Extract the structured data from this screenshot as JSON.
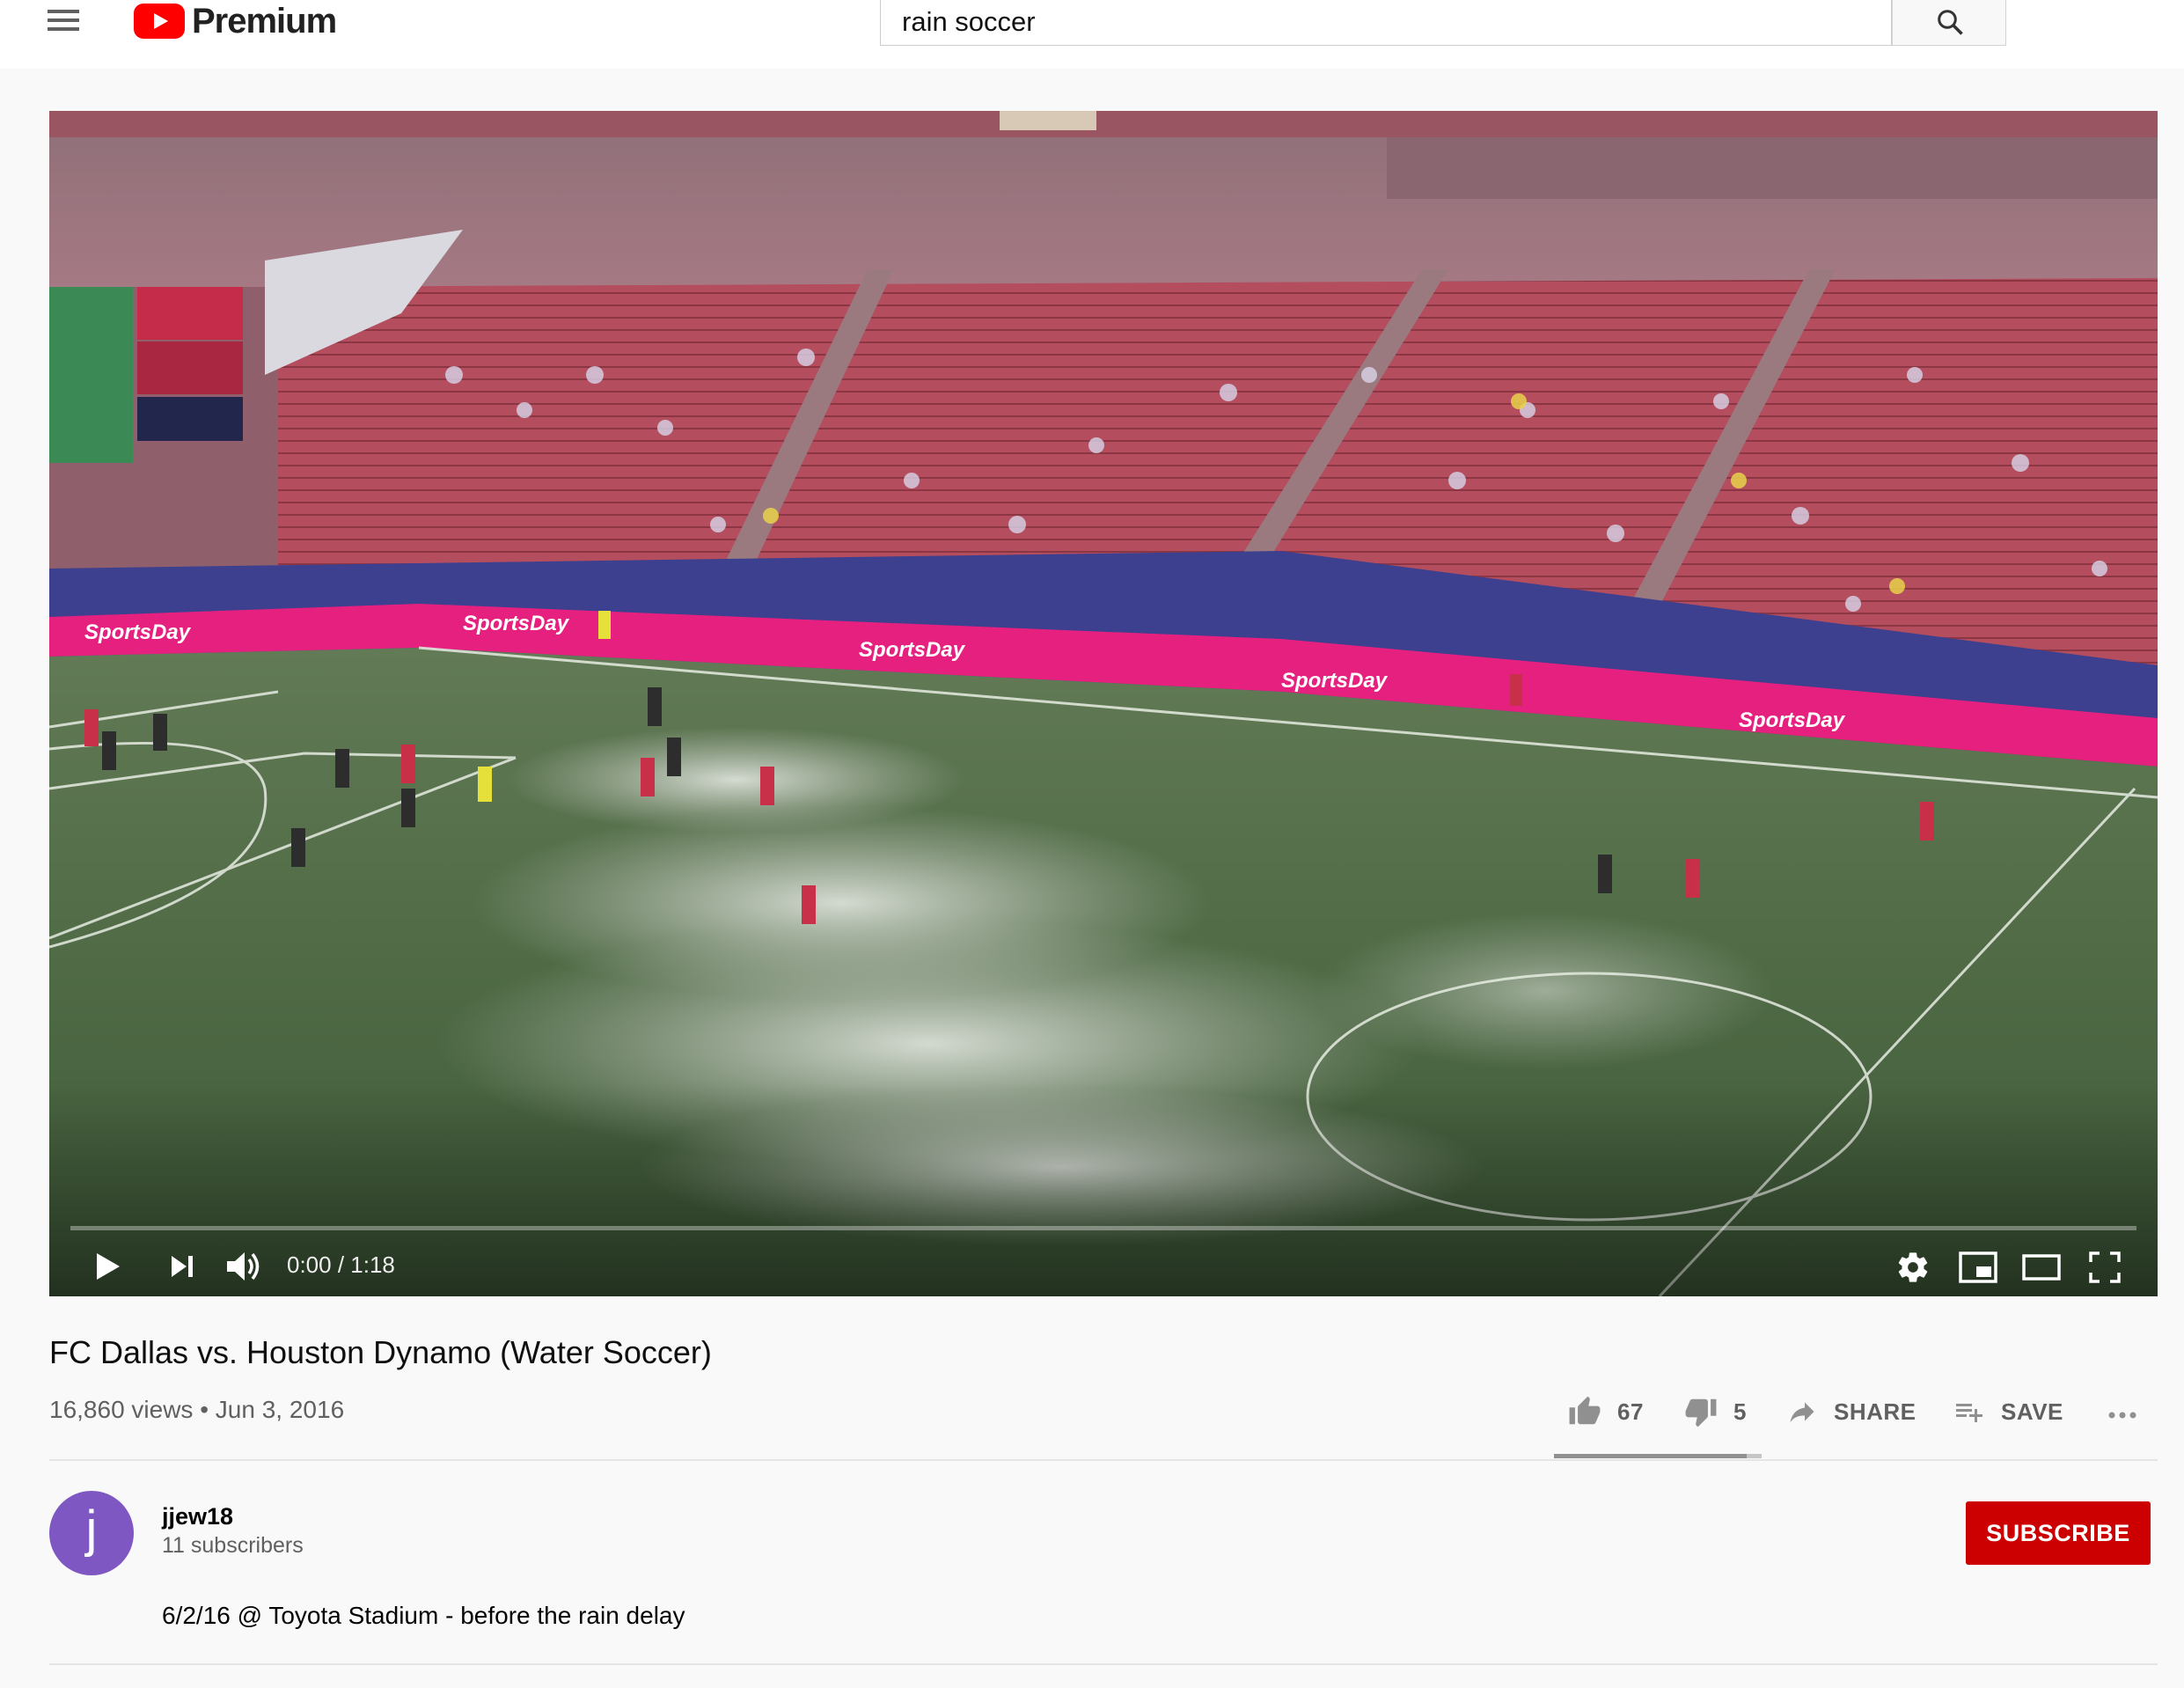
{
  "masthead": {
    "logo_text": "Premium",
    "search_value": "rain soccer",
    "brand_color": "#FF0000",
    "icons": [
      "hamburger-menu-icon",
      "youtube-logo-icon",
      "search-icon"
    ]
  },
  "player": {
    "current_time": "0:00",
    "duration": "1:18",
    "time_display": "0:00 / 1:18",
    "progress": 0,
    "icons": [
      "play-icon",
      "next-icon",
      "volume-icon",
      "settings-icon",
      "miniplayer-icon",
      "theater-mode-icon",
      "fullscreen-icon"
    ]
  },
  "video": {
    "title": "FC Dallas vs. Houston Dynamo (Water Soccer)",
    "meta": "16,860 views • Jun 3, 2016",
    "likes": "67",
    "dislikes": "5",
    "share_label": "SHARE",
    "save_label": "SAVE",
    "like_ratio": 0.93
  },
  "channel": {
    "avatar_letter": "j",
    "name": "jjew18",
    "subscribers": "11 subscribers",
    "subscribe_label": "SUBSCRIBE",
    "avatar_color": "#7E57C2",
    "subscribe_color": "#CC0000"
  },
  "description": "6/2/16 @ Toyota Stadium - before the rain delay"
}
